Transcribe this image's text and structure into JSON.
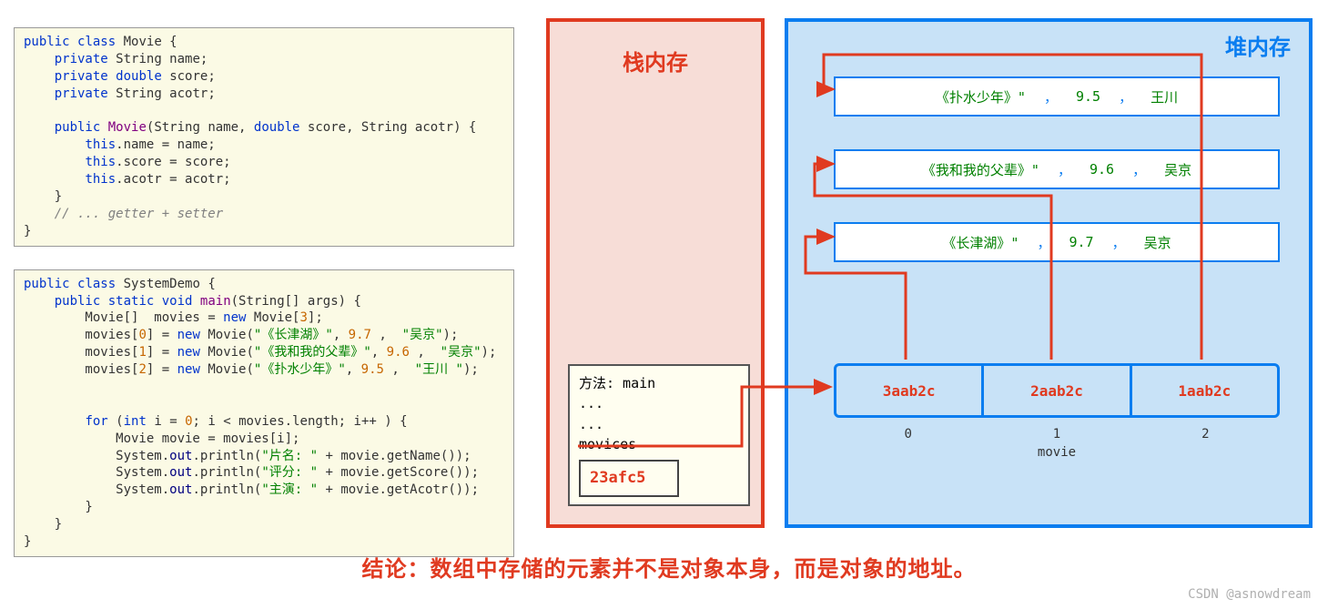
{
  "code1": {
    "l1a": "public",
    "l1b": "class",
    "l1c": "Movie {",
    "l2a": "private",
    "l2b": "String name;",
    "l3a": "private",
    "l3b": "double",
    "l3c": "score;",
    "l4a": "private",
    "l4b": "String acotr;",
    "l6a": "public",
    "l6b": "Movie",
    "l6c": "(String name,",
    "l6d": "double",
    "l6e": "score, String acotr) {",
    "l7a": "this",
    "l7b": ".name = name;",
    "l8a": "this",
    "l8b": ".score = score;",
    "l9a": "this",
    "l9b": ".acotr = acotr;",
    "l10": "    }",
    "l11": "// ... getter + setter",
    "l12": "}"
  },
  "code2": {
    "l1a": "public",
    "l1b": "class",
    "l1c": "SystemDemo {",
    "l2a": "public",
    "l2b": "static",
    "l2c": "void",
    "l2d": "main",
    "l2e": "(String[] args) {",
    "l3a": "        Movie[]  movies =",
    "l3b": "new",
    "l3c": "Movie[",
    "l3d": "3",
    "l3e": "];",
    "l4a": "        movies[",
    "l4b": "0",
    "l4c": "] =",
    "l4d": "new",
    "l4e": "Movie(",
    "l4f": "\"《长津湖》\"",
    "l4g": ",",
    "l4h": "9.7",
    "l4i": " ,",
    "l4j": "\"吴京\"",
    "l4k": ");",
    "l5a": "        movies[",
    "l5b": "1",
    "l5c": "] =",
    "l5d": "new",
    "l5e": "Movie(",
    "l5f": "\"《我和我的父辈》\"",
    "l5g": ",",
    "l5h": "9.6",
    "l5i": " ,",
    "l5j": "\"吴京\"",
    "l5k": ");",
    "l6a": "        movies[",
    "l6b": "2",
    "l6c": "] =",
    "l6d": "new",
    "l6e": "Movie(",
    "l6f": "\"《扑水少年》\"",
    "l6g": ",",
    "l6h": "9.5",
    "l6i": " ,",
    "l6j": "\"王川 \"",
    "l6k": ");",
    "l8a": "for",
    "l8b": "(",
    "l8c": "int",
    "l8d": "i =",
    "l8e": "0",
    "l8f": "; i < movies.length; i++ ) {",
    "l9": "            Movie movie = movies[i];",
    "l10a": "            System.",
    "l10b": "out",
    "l10c": ".println(",
    "l10d": "\"片名: \"",
    "l10e": " + movie.getName());",
    "l11a": "            System.",
    "l11b": "out",
    "l11c": ".println(",
    "l11d": "\"评分: \"",
    "l11e": " + movie.getScore());",
    "l12a": "            System.",
    "l12b": "out",
    "l12c": ".println(",
    "l12d": "\"主演: \"",
    "l12e": " + movie.getAcotr());",
    "l13": "        }",
    "l14": "    }",
    "l15": "}"
  },
  "stack": {
    "title": "栈内存",
    "method": "方法: main",
    "dots": "...",
    "var": "movices",
    "addr": "23afc5"
  },
  "heap": {
    "title": "堆内存",
    "obj1": {
      "name": "《扑水少年》\"",
      "score": "9.5",
      "actor": "王川"
    },
    "obj2": {
      "name": "《我和我的父辈》\"",
      "score": "9.6",
      "actor": "吴京"
    },
    "obj3": {
      "name": "《长津湖》\"",
      "score": "9.7",
      "actor": "吴京"
    },
    "sep": "，",
    "arr": [
      "3aab2c",
      "2aab2c",
      "1aab2c"
    ],
    "idx": [
      "0",
      "1",
      "2"
    ],
    "arrname": "movie"
  },
  "conclusion": "结论：数组中存储的元素并不是对象本身，而是对象的地址。",
  "watermark": "CSDN @asnowdream"
}
